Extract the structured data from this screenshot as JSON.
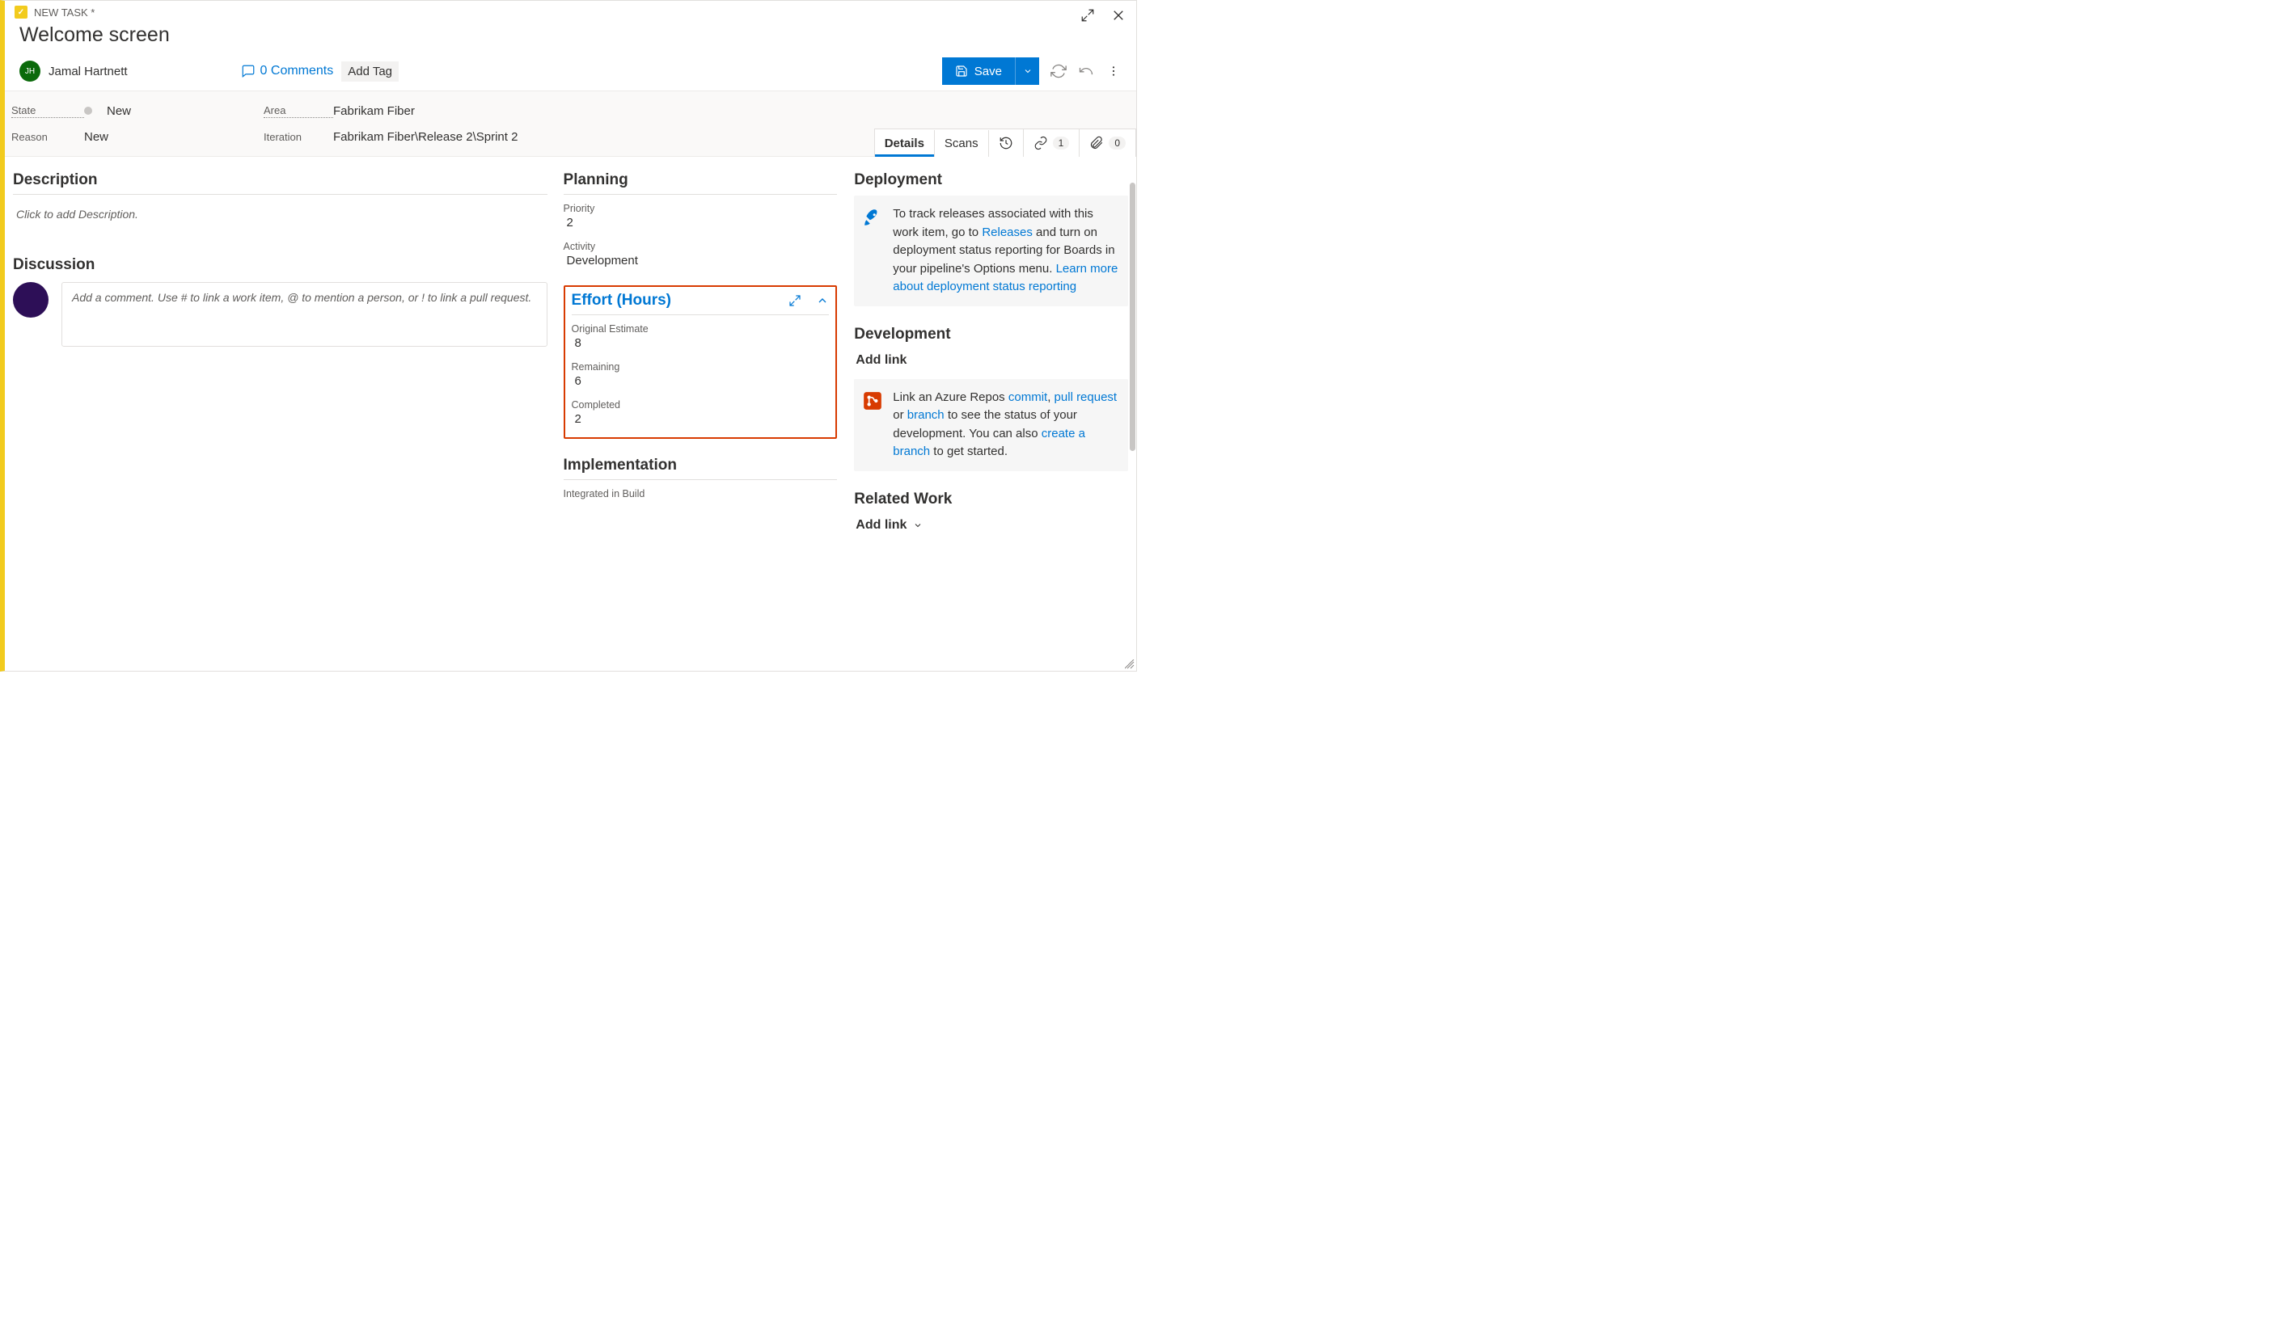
{
  "header": {
    "type_label": "NEW TASK *",
    "title": "Welcome screen",
    "assignee_initials": "JH",
    "assignee_name": "Jamal Hartnett",
    "comments_label": "0 Comments",
    "add_tag_label": "Add Tag",
    "save_label": "Save"
  },
  "classify": {
    "state_label": "State",
    "state_value": "New",
    "reason_label": "Reason",
    "reason_value": "New",
    "area_label": "Area",
    "area_value": "Fabrikam Fiber",
    "iteration_label": "Iteration",
    "iteration_value": "Fabrikam Fiber\\Release 2\\Sprint 2"
  },
  "tabs": {
    "details": "Details",
    "scans": "Scans",
    "links_count": "1",
    "attach_count": "0"
  },
  "left": {
    "description_header": "Description",
    "description_placeholder": "Click to add Description.",
    "discussion_header": "Discussion",
    "comment_placeholder": "Add a comment. Use # to link a work item, @ to mention a person, or ! to link a pull request."
  },
  "middle": {
    "planning_header": "Planning",
    "priority_label": "Priority",
    "priority_value": "2",
    "activity_label": "Activity",
    "activity_value": "Development",
    "effort_header": "Effort (Hours)",
    "original_label": "Original Estimate",
    "original_value": "8",
    "remaining_label": "Remaining",
    "remaining_value": "6",
    "completed_label": "Completed",
    "completed_value": "2",
    "implementation_header": "Implementation",
    "integrated_label": "Integrated in Build"
  },
  "right": {
    "deployment_header": "Deployment",
    "deploy_pre": "To track releases associated with this work item, go to ",
    "deploy_link1": "Releases",
    "deploy_mid": " and turn on deployment status reporting for Boards in your pipeline's Options menu. ",
    "deploy_link2": "Learn more about deployment status reporting",
    "development_header": "Development",
    "add_link_label": "Add link",
    "dev_pre": "Link an Azure Repos ",
    "dev_commit": "commit",
    "dev_c1": ", ",
    "dev_pull": "pull request",
    "dev_or": " or ",
    "dev_branch": "branch",
    "dev_mid": " to see the status of your development. You can also ",
    "dev_create": "create a branch",
    "dev_post": " to get started.",
    "related_header": "Related Work",
    "add_link2_label": "Add link"
  }
}
